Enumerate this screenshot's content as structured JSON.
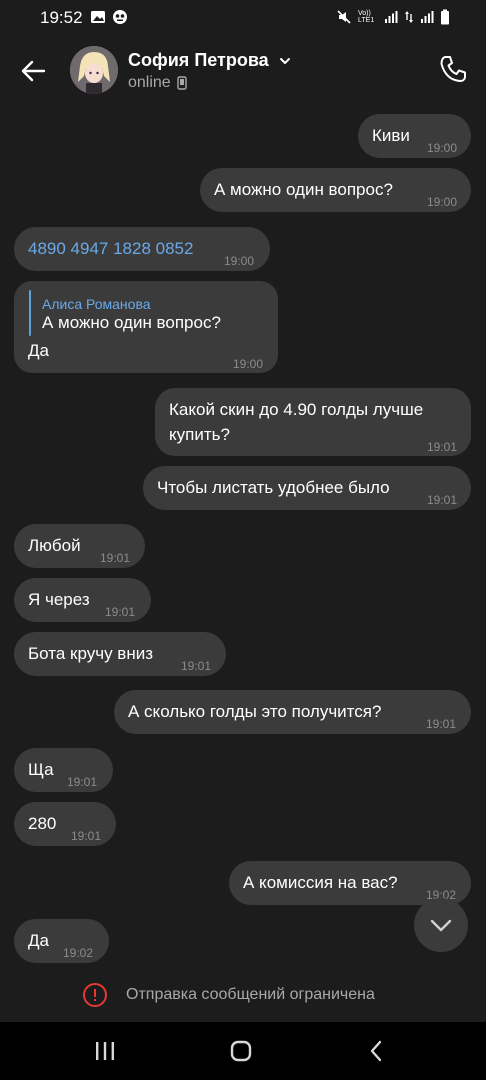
{
  "statusbar": {
    "time": "19:52",
    "icons": [
      "image-icon",
      "notification-app-icon",
      "mute-icon",
      "volte-icon",
      "signal-icon",
      "data-icon",
      "signal-icon-2",
      "battery-icon"
    ],
    "volte_label": "Vo)) LTE1"
  },
  "header": {
    "name": "София Петрова",
    "status": "online",
    "back_icon": "arrow-left-icon",
    "phone_icon": "phone-icon"
  },
  "messages": [
    {
      "side": "out",
      "text": "Киви",
      "time": "19:00"
    },
    {
      "side": "out",
      "text": "А можно один вопрос?",
      "time": "19:00"
    },
    {
      "side": "in",
      "text": "4890 4947 1828 0852",
      "time": "19:00",
      "link": true
    },
    {
      "side": "in",
      "reply_name": "Алиса Романова",
      "reply_text": "А можно один вопрос?",
      "text": "Да",
      "time": "19:00"
    },
    {
      "side": "out",
      "text_line1": "Какой скин до 4.90 голды лучше",
      "text_line2": "купить?",
      "time": "19:01"
    },
    {
      "side": "out",
      "text": "Чтобы листать удобнее было",
      "time": "19:01"
    },
    {
      "side": "in",
      "text": "Любой",
      "time": "19:01"
    },
    {
      "side": "in",
      "text": "Я через",
      "time": "19:01"
    },
    {
      "side": "in",
      "text": "Бота кручу вниз",
      "time": "19:01"
    },
    {
      "side": "out",
      "text": "А сколько голды это получится?",
      "time": "19:01"
    },
    {
      "side": "in",
      "text": "Ща",
      "time": "19:01"
    },
    {
      "side": "in",
      "text": "280",
      "time": "19:01"
    },
    {
      "side": "out",
      "text": "А комиссия на вас?",
      "time": "19:02"
    },
    {
      "side": "in",
      "text": "Да",
      "time": "19:02"
    }
  ],
  "restriction": {
    "text": "Отправка сообщений ограничена",
    "icon": "alert-circle-icon",
    "color": "#e53935"
  },
  "navbar": {
    "recent_icon": "recent-apps-icon",
    "home_icon": "home-icon",
    "back_icon": "nav-back-icon"
  },
  "colors": {
    "background": "#1c1c1c",
    "bubble": "#3b3b3b",
    "link": "#6aa9e8",
    "time": "#8b8b8b",
    "secondary_text": "#a8a8a8"
  }
}
